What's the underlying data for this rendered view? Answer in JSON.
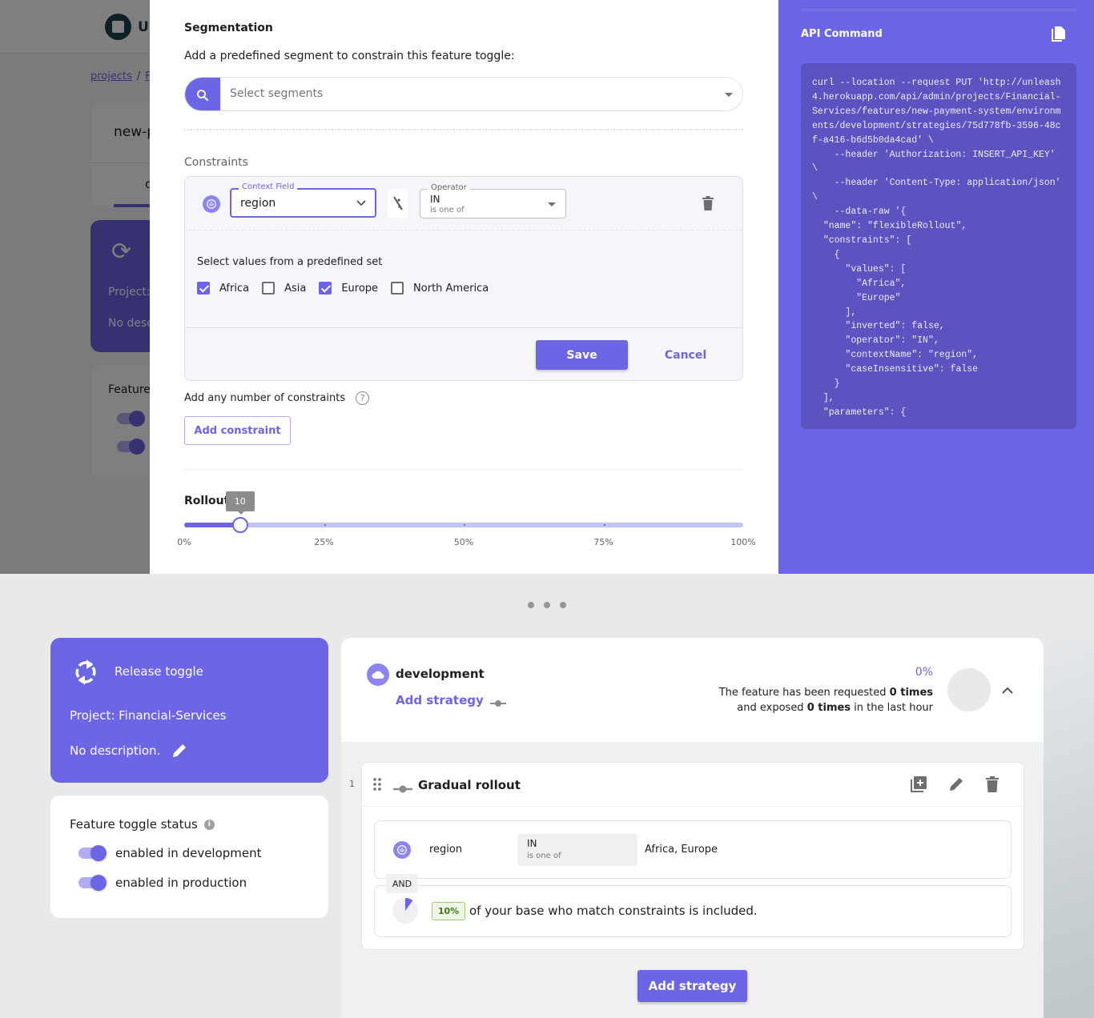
{
  "background_page": {
    "logo_text": "U",
    "breadcrumb": [
      "projects",
      "F"
    ],
    "feature_name_partial": "new-p",
    "tab_partial": "c",
    "project_partial": "Project:",
    "description_partial": "No desc",
    "status_partial": "Feature"
  },
  "modal": {
    "segmentation_title": "Segmentation",
    "segmentation_subtitle": "Add a predefined segment to constrain this feature toggle:",
    "segment_select_placeholder": "Select segments",
    "constraints_label": "Constraints",
    "constraint": {
      "context_field_label": "Context Field",
      "context_field_value": "region",
      "operator_label": "Operator",
      "operator_value": "IN",
      "operator_description": "is one of",
      "values_title": "Select values from a predefined set",
      "options": [
        {
          "label": "Africa",
          "checked": true
        },
        {
          "label": "Asia",
          "checked": false
        },
        {
          "label": "Europe",
          "checked": true
        },
        {
          "label": "North America",
          "checked": false
        }
      ],
      "save_label": "Save",
      "cancel_label": "Cancel"
    },
    "add_any_label": "Add any number of constraints",
    "help_glyph": "?",
    "add_constraint_label": "Add constraint",
    "rollout": {
      "label": "Rollout",
      "value": 10,
      "tooltip": "10",
      "min": 0,
      "max": 100,
      "tick_labels": [
        "0%",
        "25%",
        "50%",
        "75%",
        "100%"
      ],
      "tick_values": [
        0,
        25,
        50,
        75,
        100
      ]
    }
  },
  "api_panel": {
    "title": "API Command",
    "code": "curl --location --request PUT 'http://unleash4.herokuapp.com/api/admin/projects/Financial-Services/features/new-payment-system/environments/development/strategies/75d778fb-3596-48cf-a416-b6d5b0da4cad' \\\n    --header 'Authorization: INSERT_API_KEY' \\\n    --header 'Content-Type: application/json' \\\n    --data-raw '{\n  \"name\": \"flexibleRollout\",\n  \"constraints\": [\n    {\n      \"values\": [\n        \"Africa\",\n        \"Europe\"\n      ],\n      \"inverted\": false,\n      \"operator\": \"IN\",\n      \"contextName\": \"region\",\n      \"caseInsensitive\": false\n    }\n  ],\n  \"parameters\": {"
  },
  "feature_info": {
    "type": "Release toggle",
    "project": "Project: Financial-Services",
    "description": "No description."
  },
  "status": {
    "title": "Feature toggle status",
    "info_glyph": "i",
    "environments": [
      {
        "label": "enabled in development",
        "enabled": true
      },
      {
        "label": "enabled in production",
        "enabled": true
      }
    ]
  },
  "environment": {
    "name": "development",
    "add_strategy_link": "Add strategy",
    "percent": "0%",
    "metric_line1_pre": "The feature has been requested ",
    "metric_line1_bold": "0 times",
    "metric_line2_pre": "and exposed ",
    "metric_line2_bold": "0 times",
    "metric_line2_post": " in the last hour",
    "strategy": {
      "index": "1",
      "title": "Gradual rollout",
      "constraint_name": "region",
      "constraint_operator": "IN",
      "constraint_operator_desc": "is one of",
      "constraint_values": "Africa, Europe",
      "and_label": "AND",
      "rollout_percent": "10%",
      "rollout_value": 10,
      "rollout_text": "of your base who match constraints is included."
    },
    "add_strategy_button": "Add strategy"
  },
  "colors": {
    "accent": "#6c65e5",
    "accent_light": "#b1acf6",
    "rollout_badge": "#3d7a1a"
  }
}
